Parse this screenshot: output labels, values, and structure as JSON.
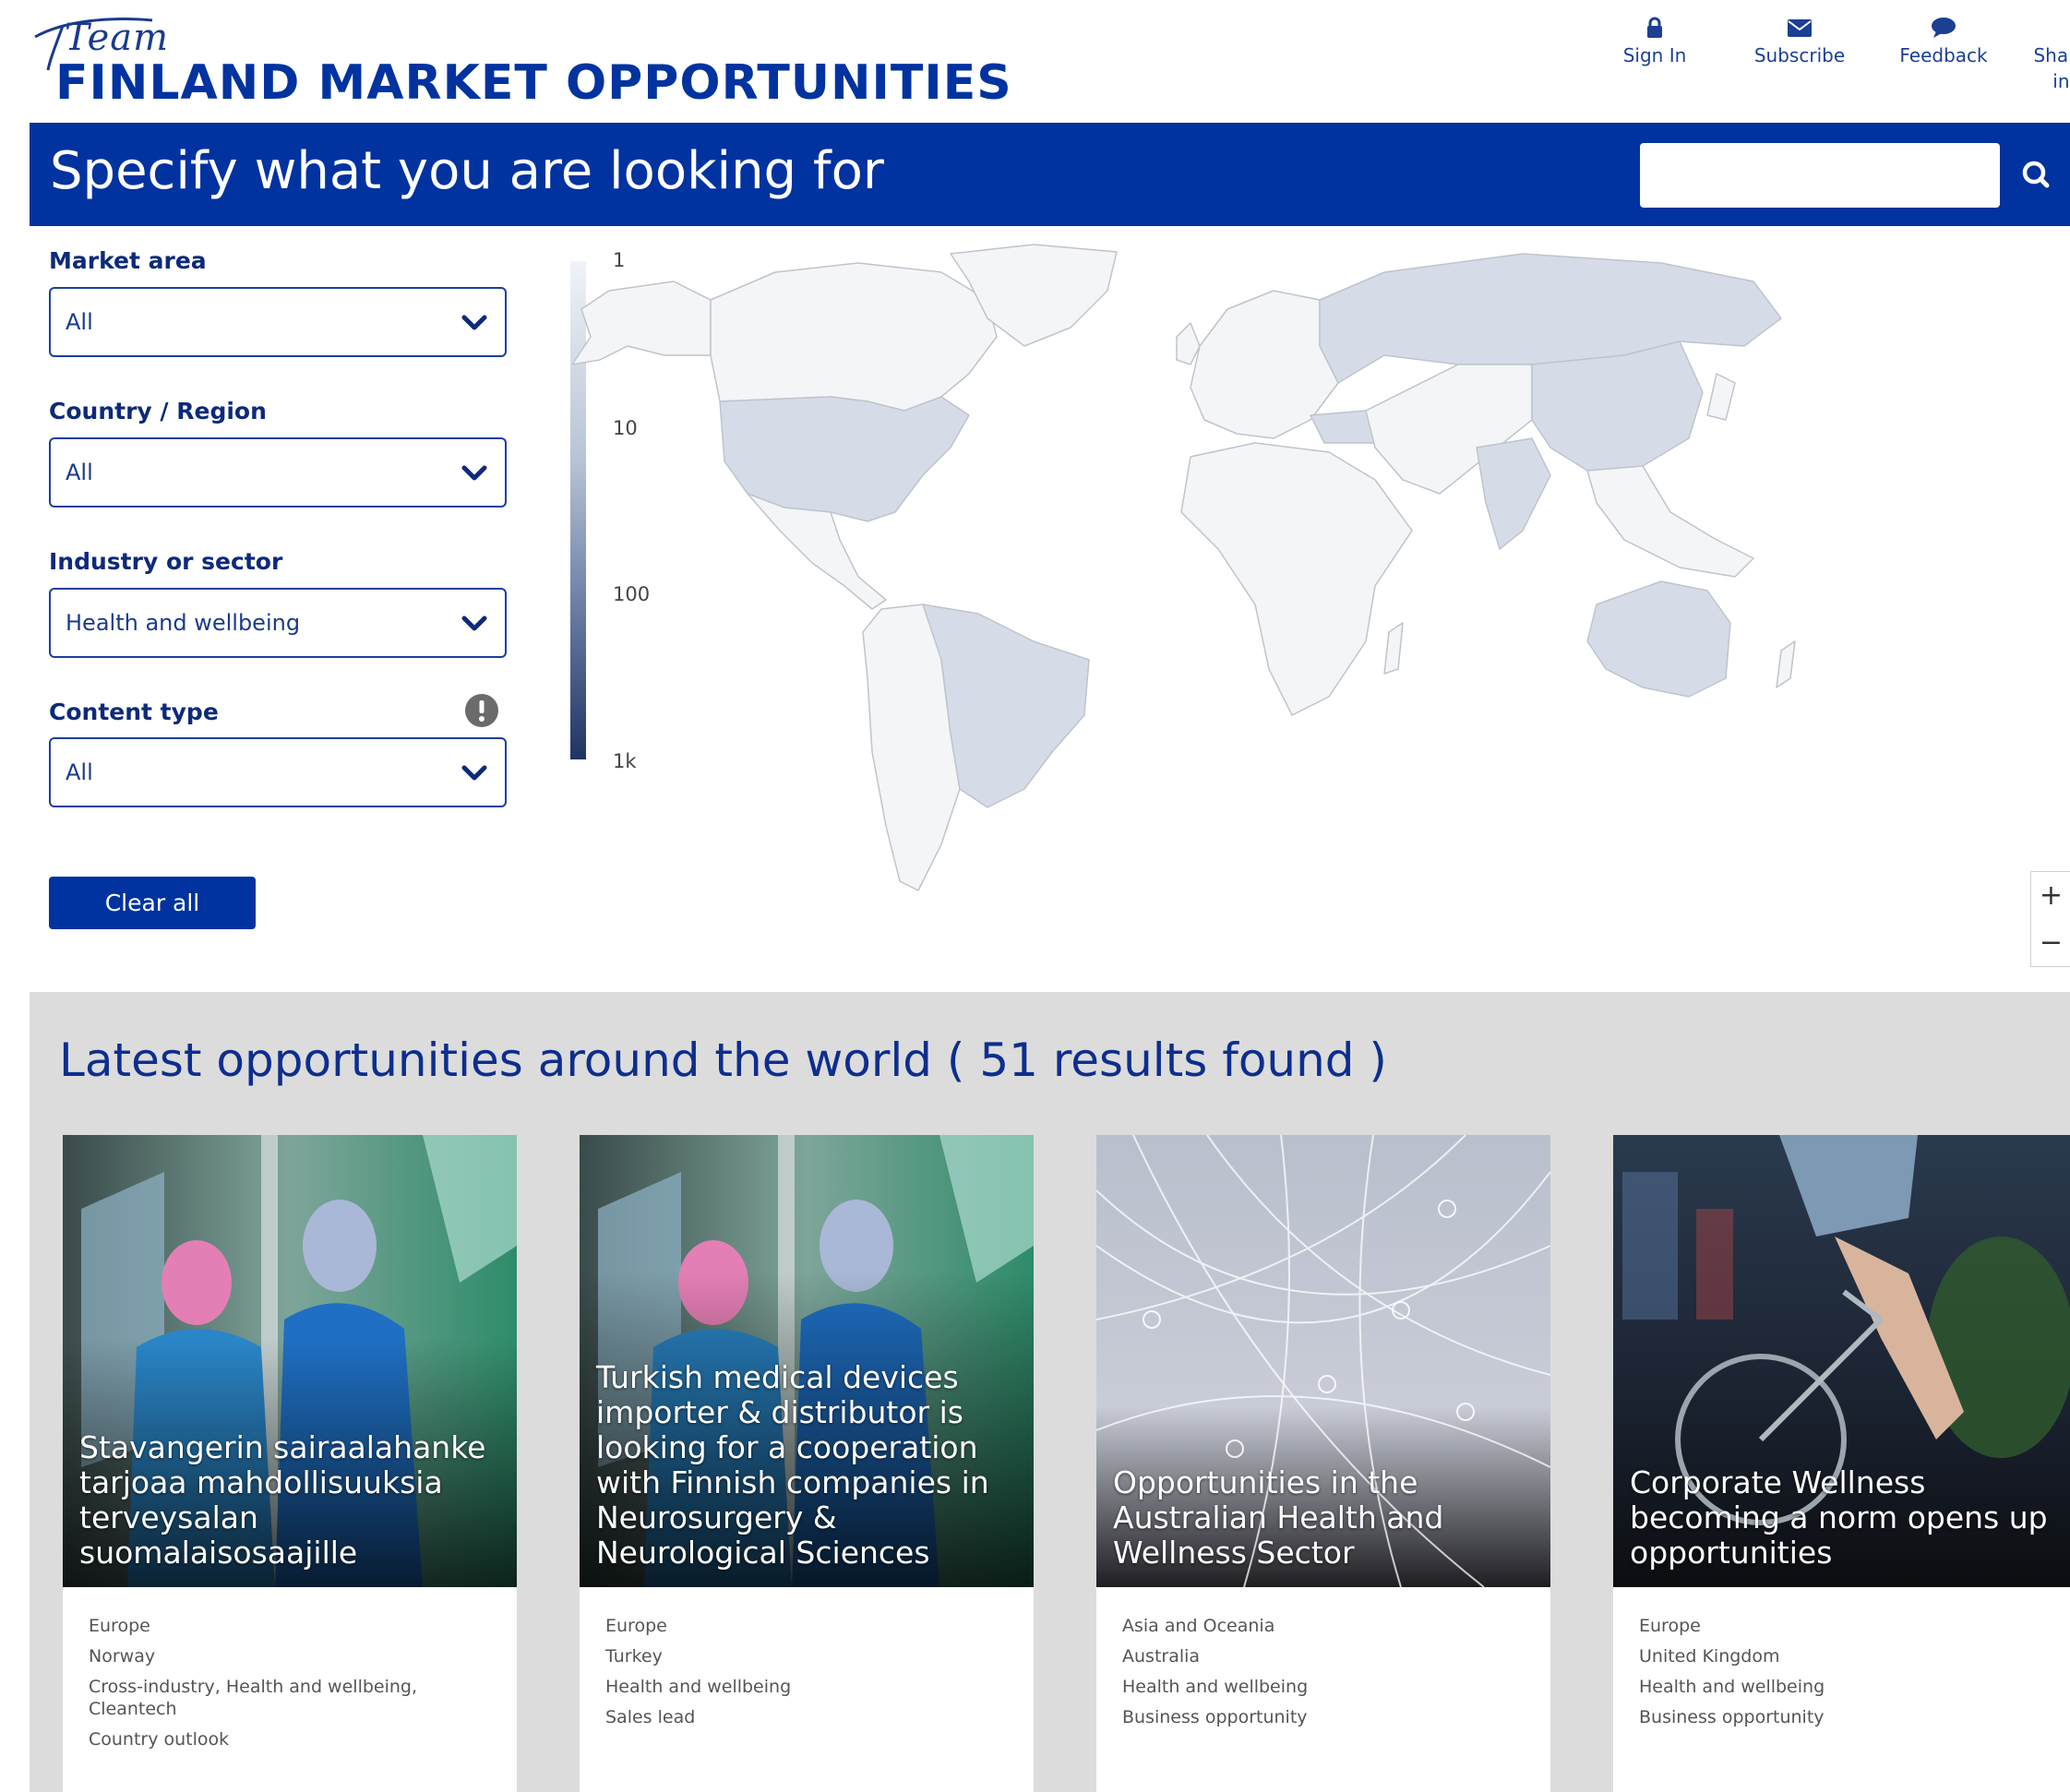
{
  "header": {
    "logo_script": "Team",
    "logo_main": "FINLAND MARKET OPPORTUNITIES",
    "nav": [
      {
        "label": "Sign In",
        "icon": "lock-icon"
      },
      {
        "label": "Subscribe",
        "icon": "envelope-icon"
      },
      {
        "label": "Feedback",
        "icon": "speech-bubble-icon"
      },
      {
        "label": "Share your insight",
        "icon": "lightbulb-icon"
      }
    ]
  },
  "search": {
    "title": "Specify what you are looking for",
    "placeholder": "",
    "value": ""
  },
  "filters": {
    "market_area": {
      "label": "Market area",
      "value": "All"
    },
    "country": {
      "label": "Country / Region",
      "value": "All"
    },
    "industry": {
      "label": "Industry or sector",
      "value": "Health and wellbeing"
    },
    "content_type": {
      "label": "Content type",
      "value": "All"
    },
    "clear_label": "Clear all"
  },
  "map": {
    "legend_ticks": [
      "1",
      "10",
      "100",
      "1k"
    ],
    "zoom_in": "+",
    "zoom_out": "−",
    "colors": {
      "land": "#f4f5f7",
      "highlight": "#d5dce8",
      "border": "#bfc4cc"
    }
  },
  "results": {
    "title": "Latest opportunities around the world ( 51 results found )",
    "cards": [
      {
        "title": "Stavangerin sairaalahanke tarjoaa mahdollisuuksia terveysalan suomalaisosaajille",
        "meta": [
          "Europe",
          "Norway",
          "Cross-industry, Health and wellbeing, Cleantech",
          "Country outlook"
        ]
      },
      {
        "title": "Turkish medical devices importer & distributor is looking for a cooperation with Finnish companies in Neurosurgery & Neurological Sciences",
        "meta": [
          "Europe",
          "Turkey",
          "Health and wellbeing",
          "Sales lead"
        ]
      },
      {
        "title": "Opportunities in the Australian Health and Wellness Sector",
        "meta": [
          "Asia and Oceania",
          "Australia",
          "Health and wellbeing",
          "Business opportunity"
        ]
      },
      {
        "title": "Corporate Wellness becoming a norm opens up opportunities",
        "meta": [
          "Europe",
          "United Kingdom",
          "Health and wellbeing",
          "Business opportunity"
        ]
      }
    ]
  },
  "colors": {
    "brand_blue": "#0033a0",
    "text_blue": "#0d2e8e",
    "results_bg": "#dcdcdc"
  }
}
